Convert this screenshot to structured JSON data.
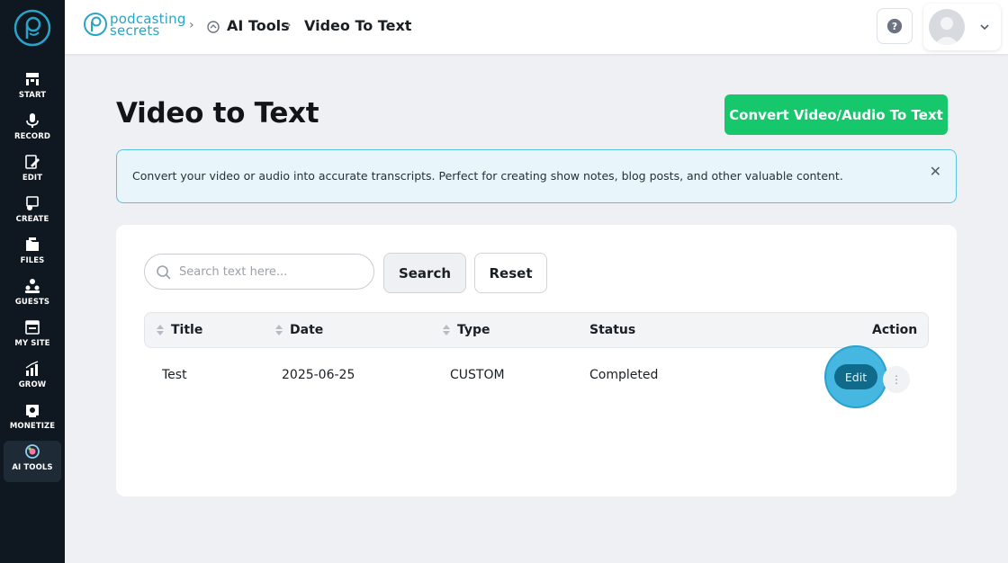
{
  "brand": {
    "line1": "podcasting",
    "line2": "secrets",
    "color": "#2aa3c9"
  },
  "breadcrumb": [
    {
      "label": "AI Tools"
    },
    {
      "label": "Video To Text"
    }
  ],
  "sidebar": {
    "items": [
      {
        "label": "START",
        "icon": "start-icon"
      },
      {
        "label": "RECORD",
        "icon": "microphone-icon"
      },
      {
        "label": "EDIT",
        "icon": "edit-icon"
      },
      {
        "label": "CREATE",
        "icon": "create-icon"
      },
      {
        "label": "FILES",
        "icon": "folder-icon"
      },
      {
        "label": "GUESTS",
        "icon": "guests-icon"
      },
      {
        "label": "MY SITE",
        "icon": "site-icon"
      },
      {
        "label": "GROW",
        "icon": "chart-icon"
      },
      {
        "label": "MONETIZE",
        "icon": "monetize-icon"
      },
      {
        "label": "AI TOOLS",
        "icon": "ai-tools-icon",
        "active": true
      }
    ]
  },
  "header": {
    "help_icon": "question-icon",
    "profile_icon": "chevron-down-icon"
  },
  "page": {
    "title": "Video to Text",
    "convert_button": "Convert Video/Audio To Text",
    "alert": "Convert your video or audio into accurate transcripts. Perfect for creating show notes, blog posts, and other valuable content.",
    "alert_close": "✕"
  },
  "search": {
    "placeholder": "Search text here...",
    "value": ""
  },
  "buttons": {
    "search": "Search",
    "reset": "Reset"
  },
  "table": {
    "columns": [
      "Title",
      "Date",
      "Type",
      "Status",
      "Action"
    ],
    "rows": [
      {
        "title": "Test",
        "date": "2025-06-25",
        "type": "CUSTOM",
        "status": "Completed",
        "action": "Edit"
      }
    ]
  },
  "colors": {
    "accent_green": "#16c76b",
    "accent_blue": "#45b7e0",
    "sidebar_bg": "#0f1720"
  }
}
